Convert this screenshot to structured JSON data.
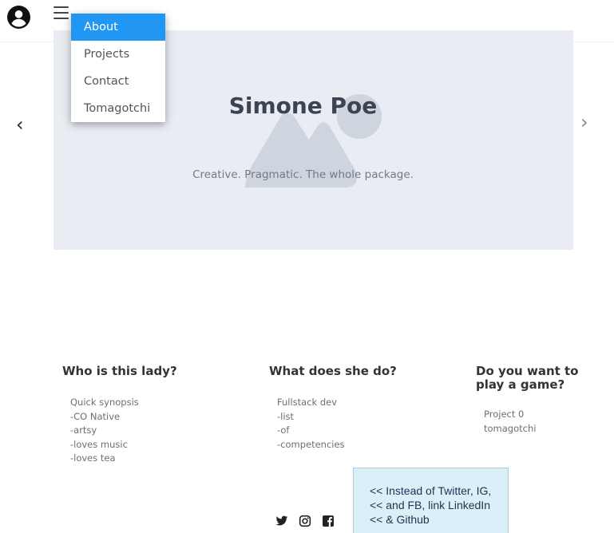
{
  "header": {
    "avatar_icon": "user-circle-icon",
    "menu_icon": "hamburger-icon"
  },
  "menu": {
    "items": [
      {
        "label": "About",
        "active": true
      },
      {
        "label": "Projects",
        "active": false
      },
      {
        "label": "Contact",
        "active": false
      },
      {
        "label": "Tomagotchi",
        "active": false
      }
    ],
    "active_color": "#2196f3"
  },
  "hero": {
    "title": "Simone Poe",
    "subtitle": "Creative. Pragmatic. The whole package.",
    "placeholder_icon": "image-placeholder-icon",
    "prev_label": "‹",
    "next_label": "›"
  },
  "columns": [
    {
      "title": "Who is this lady?",
      "items": [
        "Quick synopsis",
        "-CO Native",
        "-artsy",
        "-loves music",
        "-loves tea"
      ]
    },
    {
      "title": "What does she do?",
      "items": [
        "Fullstack dev",
        "-list",
        "-of",
        "-competencies"
      ]
    },
    {
      "title": "Do you want to play a game?",
      "items": [
        "Project 0",
        "tomagotchi"
      ]
    }
  ],
  "note": {
    "lines": [
      "<< Instead of Twitter, IG,",
      "<< and FB, link LinkedIn",
      "<< & Github"
    ],
    "background": "#dbeff9"
  },
  "social": [
    "twitter-icon",
    "instagram-icon",
    "facebook-icon"
  ]
}
